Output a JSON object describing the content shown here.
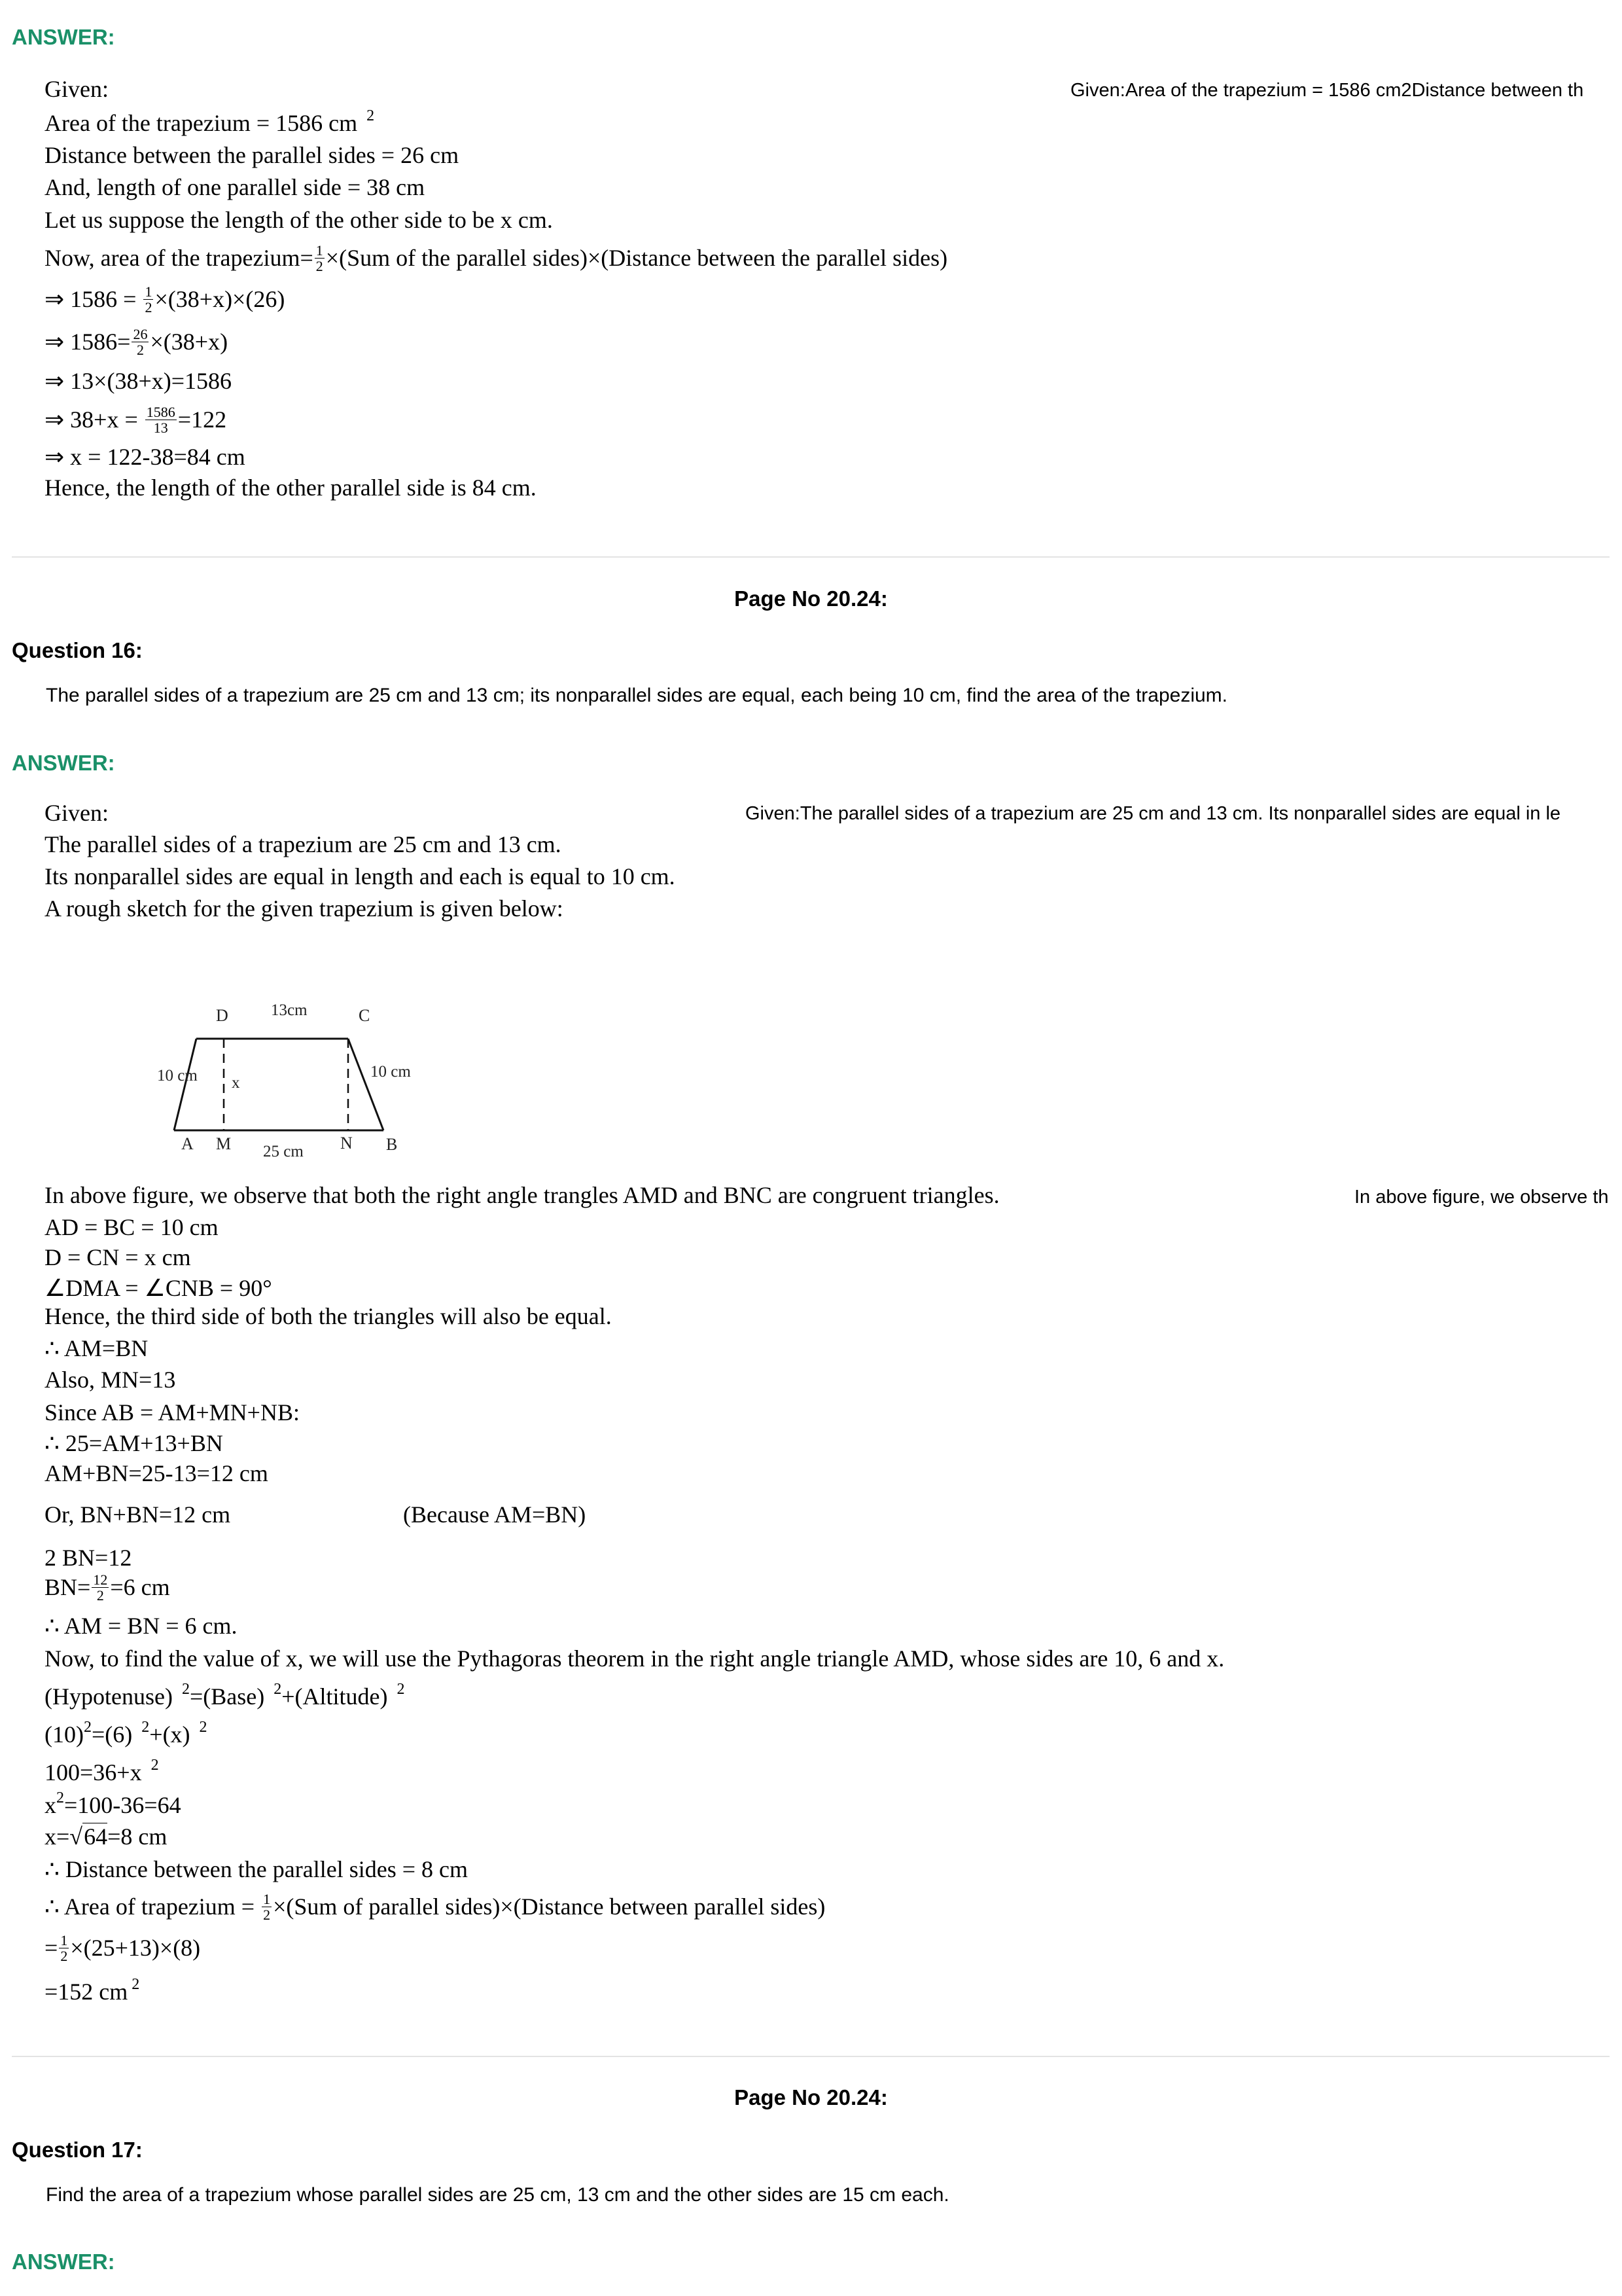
{
  "answer_label": "ANSWER:",
  "page_no_label": "Page No 20.24:",
  "q15_answer": {
    "side_summary": "Given:Area of the trapezium = 1586 cm2Distance between th",
    "given": "Given:",
    "area_text": "Area of the trapezium = 1586 cm",
    "area_exp": "2",
    "distance": "Distance between the parallel sides = 26 cm",
    "one_side": "And, length of one parallel side = 38 cm",
    "suppose": "Let us suppose the length of the other side to be x  cm.",
    "formula_a": "Now, area of the trapezium=",
    "formula_b": "×(Sum of the parallel sides)×(Distance between the parallel sides)",
    "step1_a": "⇒ 1586 = ",
    "step1_b": "×(38+x)×(26)",
    "step2_a": "⇒ 1586=",
    "step2_b": "×(38+x)",
    "step3": "⇒ 13×(38+x)=1586",
    "step4_a": "⇒ 38+x = ",
    "step4_b": "=122",
    "step5": "⇒ x = 122-38=84 cm",
    "conclusion": "Hence, the length of the other parallel side is 84 cm.",
    "frac_half_n": "1",
    "frac_half_d": "2",
    "frac_26_n": "26",
    "frac_26_d": "2",
    "frac_1586_n": "1586",
    "frac_1586_d": "13"
  },
  "q16": {
    "label": "Question 16:",
    "text": "The parallel sides of a trapezium are 25 cm and 13 cm; its nonparallel sides are equal, each being 10 cm, find the area of the trapezium."
  },
  "q16_answer": {
    "side_summary": "Given:The parallel sides of a trapezium are 25 cm and 13 cm. Its nonparallel sides are equal in le",
    "side_summary2": "In above figure, we observe th",
    "given": "Given:",
    "l1": "The parallel sides of a trapezium are 25 cm and 13 cm.",
    "l2": "Its nonparallel sides are equal in length and each is equal to 10 cm.",
    "l3": "A rough sketch for the given trapezium is given below:",
    "figure": {
      "D": "D",
      "C": "C",
      "A": "A",
      "M": "M",
      "N": "N",
      "B": "B",
      "top": "13cm",
      "bottom": "25 cm",
      "left": "10 cm",
      "right": "10 cm",
      "x": "x"
    },
    "obs": "In above figure, we observe that both the right angle trangles AMD and BNC are congruent triangles.",
    "ad": "AD   =   BC   =  10  cm",
    "d_cn": "D  =   CN   =  x  cm",
    "angle": "∠DMA    = ∠CNB    =  90°",
    "third": "Hence, the third side of both the triangles will also be equal.",
    "am_bn": "∴ AM=BN",
    "mn": "Also, MN=13",
    "since": "Since AB = AM+MN+NB:",
    "s25": "∴  25=AM+13+BN",
    "sum": "AM+BN=25-13=12 cm",
    "or": "Or, BN+BN=12 cm",
    "because": "(Because AM=BN)",
    "two_bn": "2 BN=12",
    "bn_a": "BN=",
    "bn_b": "=6 cm",
    "frac_12_n": "12",
    "frac_12_d": "2",
    "am6": "∴  AM = BN = 6 cm.",
    "now": "Now, to find the value of x, we will use the Pythagoras theorem in the right angle triangle AMD, whose sides are 10, 6 and x.",
    "pyth_a": "(Hypotenuse)",
    "pyth_b": "=(Base)",
    "pyth_c": "+(Altitude)",
    "exp2": "2",
    "p2_a": "(10)",
    "p2_b": "=(6)",
    "p2_c": "+(x)",
    "p3_a": "100=36+x",
    "p4_a": "x",
    "p4_b": "=100-36=64",
    "p5_a": "x=√",
    "p5_b": "64",
    "p5_c": "=8 cm",
    "dist": "∴ Distance  between the parallel sides = 8 cm",
    "area_a": "∴  Area of trapezium = ",
    "area_b": "×(Sum of parallel sides)×(Distance between parallel sides)",
    "calc_a": "=",
    "calc_b": "×(25+13)×(8)",
    "result": "=152 cm",
    "frac_half_n": "1",
    "frac_half_d": "2"
  },
  "q17": {
    "label": "Question 17:",
    "text": "Find the area of a trapezium whose parallel sides are 25 cm, 13 cm and the other sides are 15 cm each."
  }
}
